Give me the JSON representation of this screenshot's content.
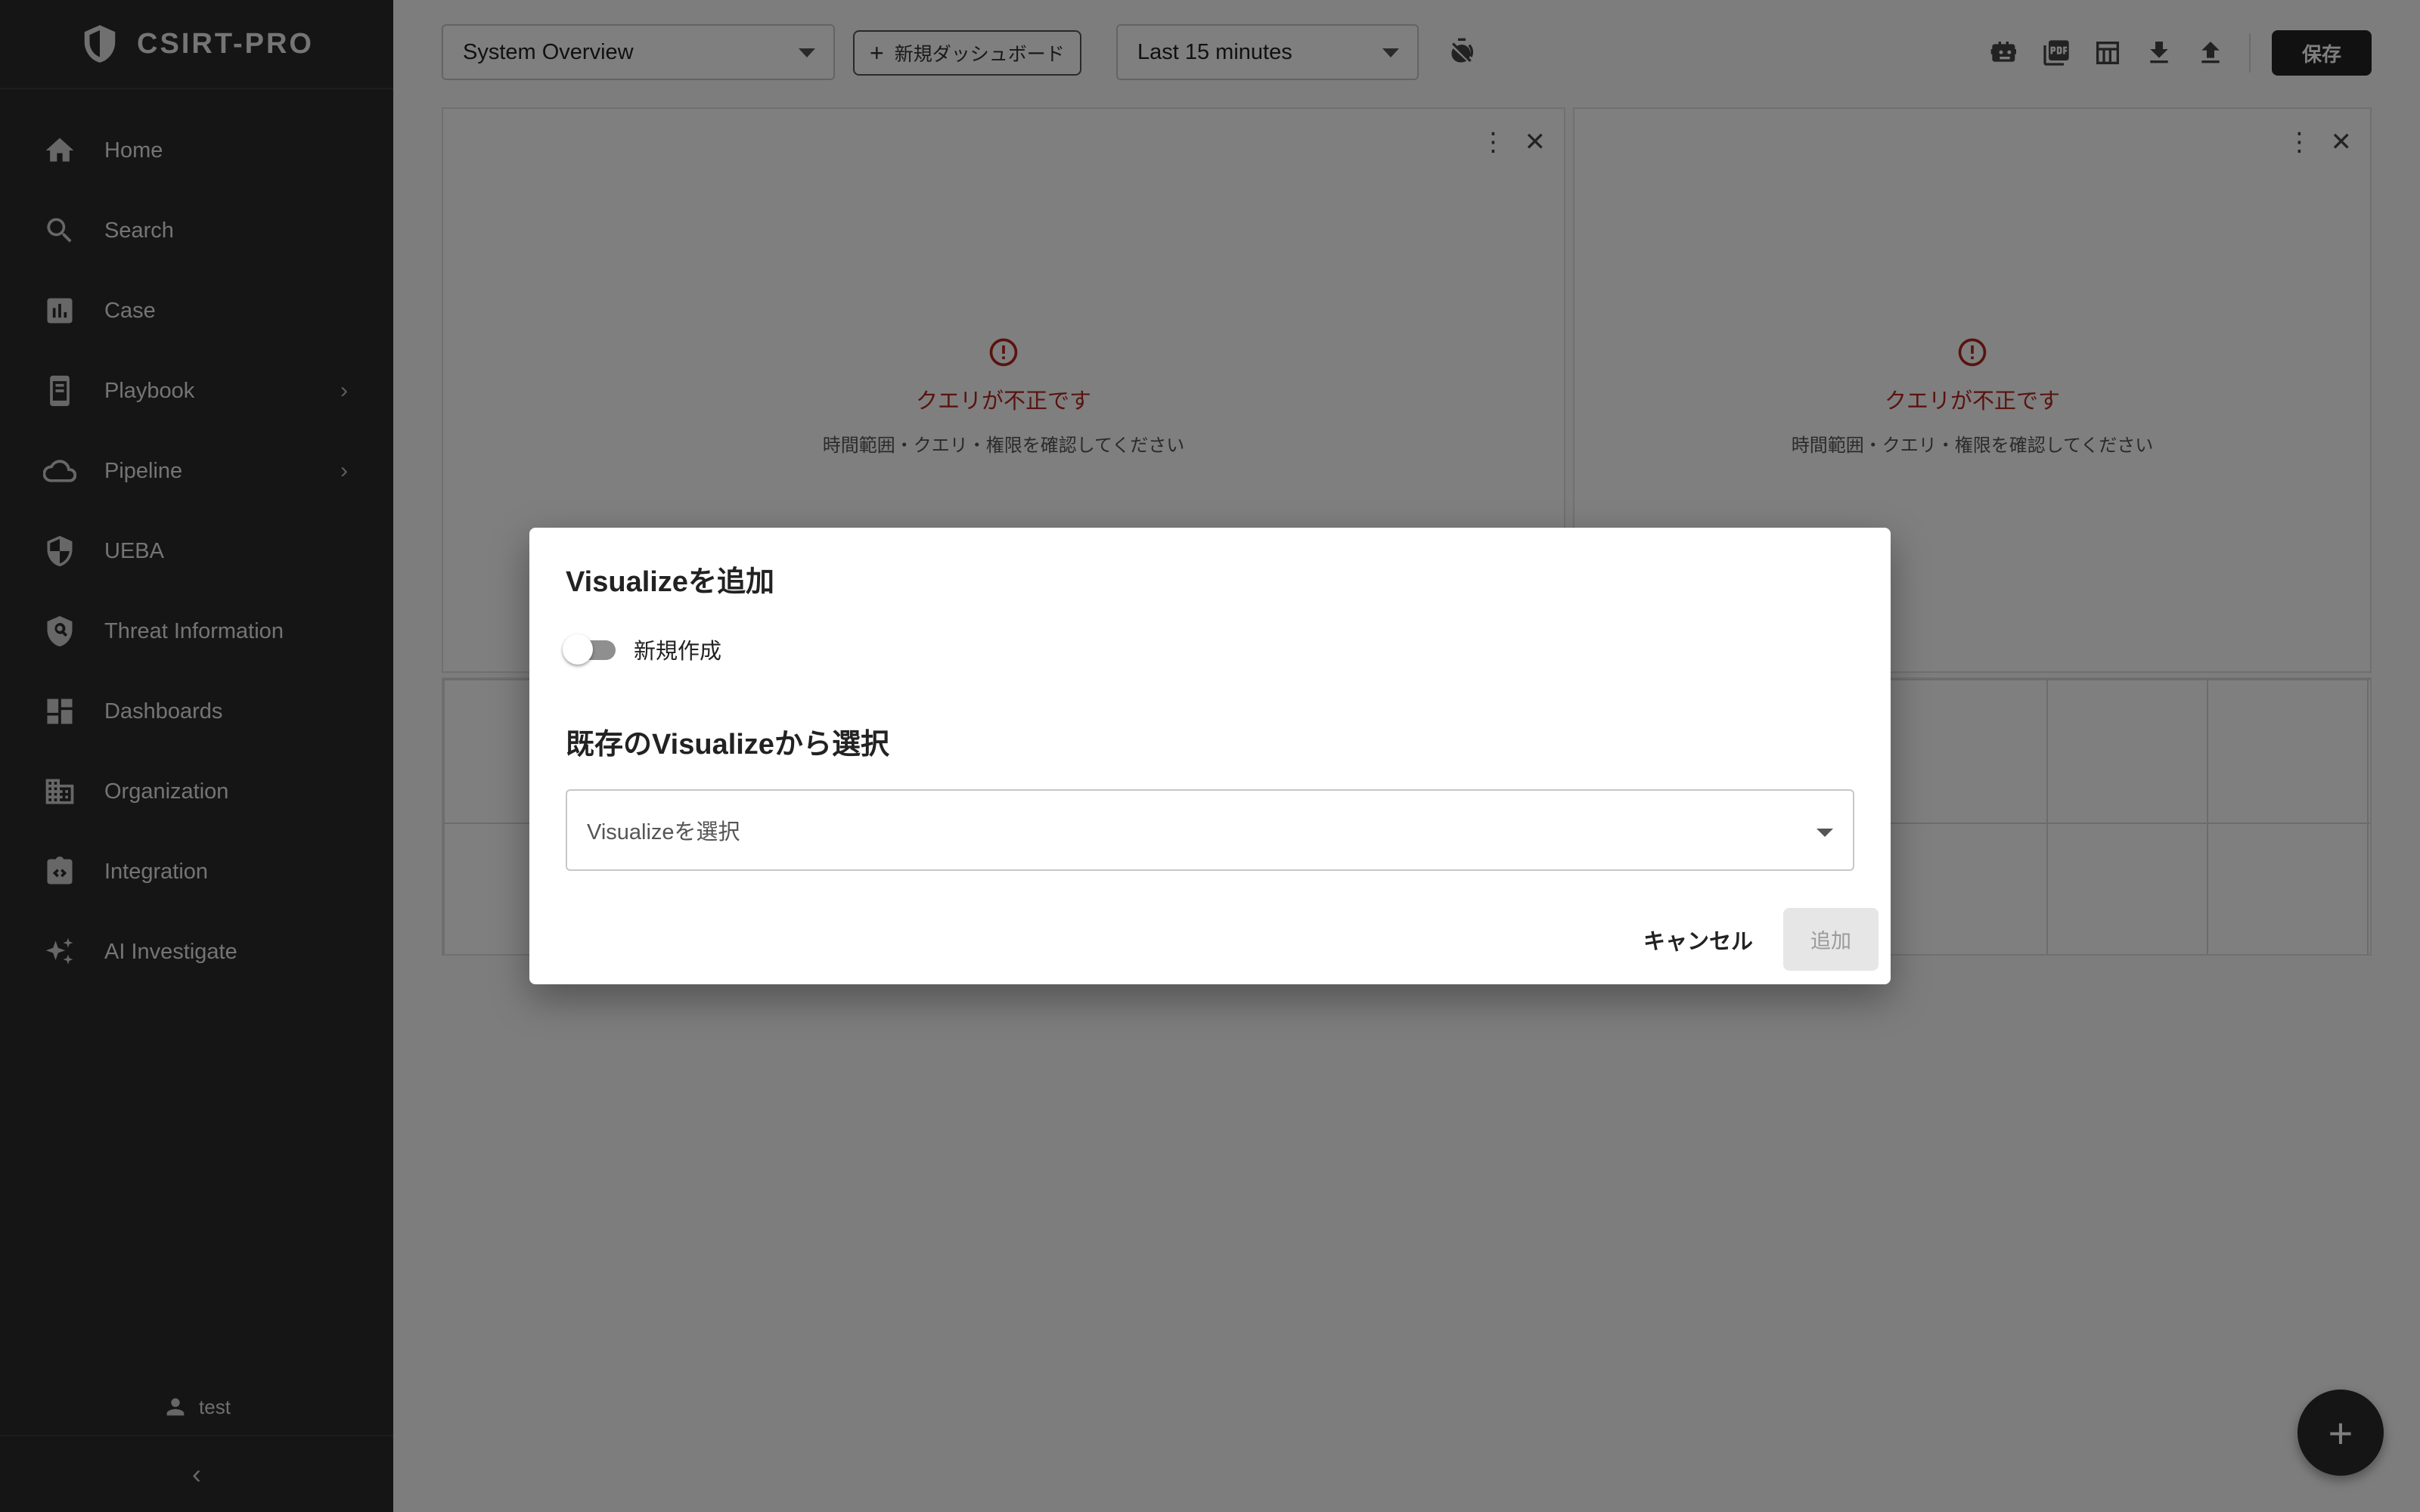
{
  "app": {
    "name": "CSIRT-PRO"
  },
  "sidebar": {
    "items": [
      {
        "label": "Home"
      },
      {
        "label": "Search"
      },
      {
        "label": "Case"
      },
      {
        "label": "Playbook",
        "has_submenu": true
      },
      {
        "label": "Pipeline",
        "has_submenu": true
      },
      {
        "label": "UEBA"
      },
      {
        "label": "Threat Information"
      },
      {
        "label": "Dashboards"
      },
      {
        "label": "Organization"
      },
      {
        "label": "Integration"
      },
      {
        "label": "AI Investigate"
      }
    ],
    "user": "test"
  },
  "toolbar": {
    "dashboard_select": "System Overview",
    "new_dashboard_label": "新規ダッシュボード",
    "time_range": "Last 15 minutes",
    "save_label": "保存"
  },
  "panels": [
    {
      "error_title": "クエリが不正です",
      "error_message": "時間範囲・クエリ・権限を確認してください"
    },
    {
      "error_title": "クエリが不正です",
      "error_message": "時間範囲・クエリ・権限を確認してください"
    }
  ],
  "modal": {
    "title": "Visualizeを追加",
    "toggle_label": "新規作成",
    "toggle_on": false,
    "section_title": "既存のVisualizeから選択",
    "select_placeholder": "Visualizeを選択",
    "cancel_label": "キャンセル",
    "add_label": "追加",
    "add_enabled": false
  },
  "colors": {
    "error": "#b3261e",
    "sidebar": "#2b2b2b",
    "accent": "#222222"
  }
}
